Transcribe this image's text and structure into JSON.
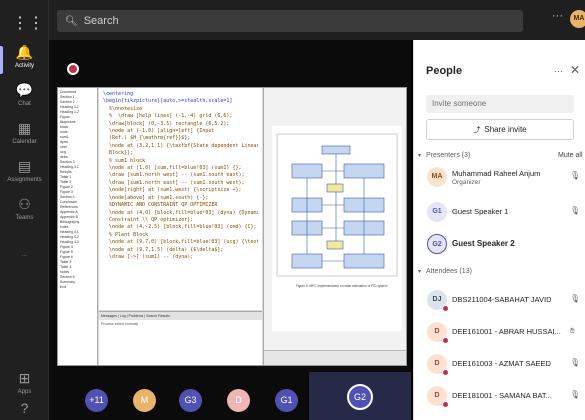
{
  "app": {
    "search_placeholder": "Search",
    "more_label": "···",
    "user_initials": "MA"
  },
  "rail": {
    "items": [
      {
        "label": "Activity",
        "icon": "bell-icon",
        "glyph": "🔔"
      },
      {
        "label": "Chat",
        "icon": "chat-icon",
        "glyph": "💬"
      },
      {
        "label": "Calendar",
        "icon": "calendar-icon",
        "glyph": "▦"
      },
      {
        "label": "Assignments",
        "icon": "assignments-icon",
        "glyph": "▤"
      },
      {
        "label": "Teams",
        "icon": "teams-icon",
        "glyph": "⚇"
      },
      {
        "label": "···",
        "icon": "more-apps-icon",
        "glyph": ""
      }
    ],
    "bottom": [
      {
        "label": "Apps",
        "icon": "apps-icon",
        "glyph": "⊞"
      },
      {
        "label": "",
        "icon": "help-icon",
        "glyph": "?"
      }
    ]
  },
  "shared_screen": {
    "code_lines": [
      "\\centering",
      "\\begin{tikzpicture}[auto,>=stealth,scale=1]",
      "  %\\nnotesize",
      "  %  \\draw [help lines] (-1,-4) grid (6,6);",
      "  \\draw[block] (0,-3.5) rectangle (6,5.2);",
      "  \\node at (-1,0) [align=left] {Input",
      "  (Ref.) $H_{\\mathrm{ref}}$};",
      "  \\node at (3.2,1.1) {\\textbf{State dependent Linear MPC",
      "  Block}};",
      "  % sum1 block",
      "  \\node at (1,0) [sum,fill=blue!03] (sum1) {};",
      "  \\draw [sum1.north west] -- (sum1.south east);",
      "  \\draw [sum1.north east] -- (sum1.south west);",
      "  \\node[right] at (sum1.west) {\\scriptsize +};",
      "  \\node[above] at (sum1.south) {-};",
      "  %DYNAMIC AND CONSTRAINT QP OPTIMIZER",
      "  \\node at (4,0) [block,fill=blue!03] (dyna) {Dynamic and",
      "  Constraint \\\\ QP optimizer};",
      "  \\node at (4,-2.5) [block,fill=blue!03] (cmd) {C};",
      "  % Plant Block",
      "  \\node at (9.7,0) [block,fill=blue!03] (ucg) {\\textbf{UCG}};",
      "  \\node at (9.7,1.5) (delta) {$\\delta$};",
      "  \\draw [->] (sum1) -- (dyna);"
    ],
    "log_tabs": "Messages | Log | Problems | Search Results",
    "log_text": "Process exited normally",
    "figure_caption": "Figure 6:  MPC implementation on state estimation of PID system",
    "tree_items": [
      "Document",
      "Section 1",
      "Section 2",
      "Heading 1.1",
      "Heading 1.2",
      "Figure",
      "tikzpicture",
      "block",
      "node",
      "sum1",
      "dyna",
      "cmd",
      "ucg",
      "delta",
      "Section 3",
      "Heading 3.1",
      "Results",
      "Table 1",
      "Table 2",
      "Figure 2",
      "Figure 3",
      "Section 4",
      "Conclusion",
      "References",
      "Appendix A",
      "Appendix B",
      "Bibliography",
      "Index",
      "Heading 4.1",
      "Heading 4.2",
      "Heading 4.3",
      "Figure 4",
      "Figure 5",
      "Figure 6",
      "Table 3",
      "Table 4",
      "Notes",
      "Section 5",
      "Summary",
      "End"
    ],
    "colors": {
      "diagram_block": "#c5d7f0",
      "diagram_edge": "#3a5fa8",
      "diagram_sum": "#f3e79c"
    }
  },
  "participants": [
    {
      "initials": "+11",
      "color": "#4f52b2"
    },
    {
      "initials": "M",
      "color": "#e9b36a"
    },
    {
      "initials": "G3",
      "color": "#4f52b2"
    },
    {
      "initials": "D",
      "color": "#f0b6b6"
    },
    {
      "initials": "G1",
      "color": "#4f52b2"
    }
  ],
  "self_tile": {
    "initials": "G2"
  },
  "panel": {
    "title": "People",
    "more": "···",
    "close": "✕",
    "invite_placeholder": "Invite someone",
    "share_label": "Share invite",
    "presenters_header": "Presenters (3)",
    "mute_all": "Mute all",
    "attendees_header": "Attendees (13)",
    "presenters": [
      {
        "initials": "MA",
        "name": "Muhammad Raheel Anjum",
        "role": "Organizer",
        "bg": "#fbe3cf",
        "fg": "#8a4a12",
        "style": "normal"
      },
      {
        "initials": "G1",
        "name": "Guest Speaker 1",
        "role": "",
        "bg": "#e5e5f5",
        "fg": "#4f52b2",
        "style": "mid"
      },
      {
        "initials": "G2",
        "name": "Guest Speaker 2",
        "role": "",
        "bg": "#e5e5f5",
        "fg": "#4f52b2",
        "style": "bold"
      }
    ],
    "attendees": [
      {
        "initials": "DJ",
        "name": "DBS211004-SABAHAT JAVID",
        "bg": "#dde3ea",
        "fg": "#3a4a5a"
      },
      {
        "initials": "D",
        "name": "DEE161001 - ABRAR HUSSAI...",
        "bg": "#fbe3cf",
        "fg": "#c4314b"
      },
      {
        "initials": "D",
        "name": "DEE161003 - AZMAT SAEED",
        "bg": "#fbe3cf",
        "fg": "#c4314b"
      },
      {
        "initials": "D",
        "name": "DEE181001 - SAMANA BAT...",
        "bg": "#fbe3cf",
        "fg": "#c4314b"
      }
    ]
  }
}
